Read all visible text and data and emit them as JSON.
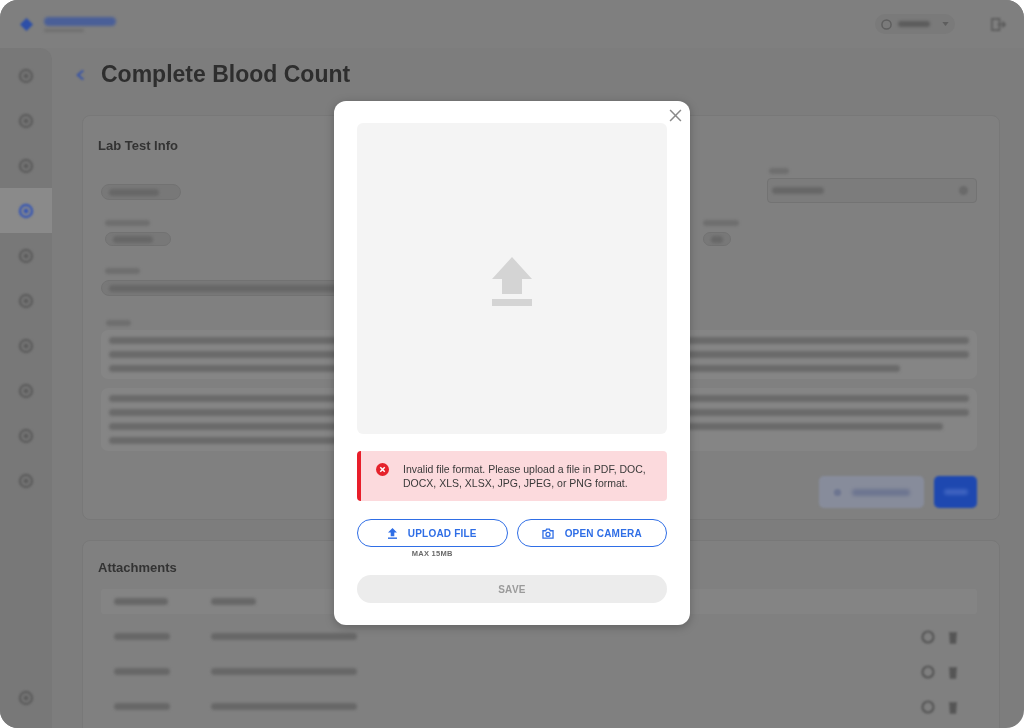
{
  "sidebar": {
    "items": [
      {
        "selected": false
      },
      {
        "selected": false
      },
      {
        "selected": false
      },
      {
        "selected": true
      },
      {
        "selected": false
      },
      {
        "selected": false
      },
      {
        "selected": false
      },
      {
        "selected": false
      },
      {
        "selected": false
      },
      {
        "selected": false
      }
    ],
    "bottom_items": [
      {
        "selected": false
      }
    ]
  },
  "page": {
    "title": "Complete Blood Count",
    "sections": [
      {
        "kind": "info",
        "title": "Lab Test Info"
      },
      {
        "kind": "attachments",
        "title": "Attachments"
      }
    ]
  },
  "dialog": {
    "alert": {
      "kind": "error",
      "text": "Invalid file format. Please upload a file in PDF, DOC, DOCX, XLS, XLSX, JPG, JPEG, or PNG format."
    },
    "actions": [
      {
        "kind": "upload",
        "label": "UPLOAD FILE",
        "note": "MAX 15MB"
      },
      {
        "kind": "camera",
        "label": "OPEN CAMERA"
      }
    ],
    "save": {
      "label": "SAVE",
      "disabled": true
    }
  }
}
